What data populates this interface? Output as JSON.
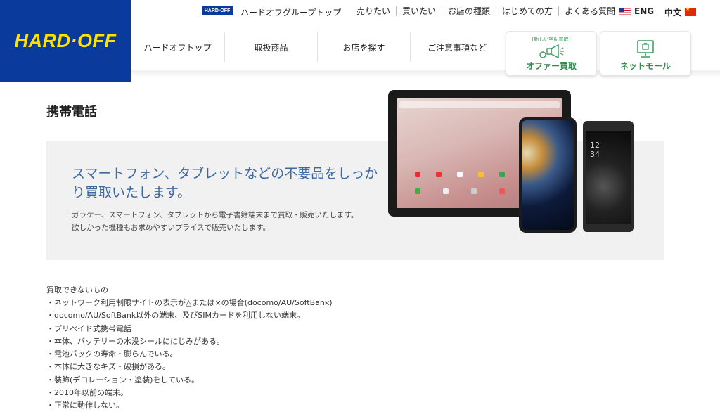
{
  "logo": {
    "text": "HARD·OFF"
  },
  "utility": {
    "group_logo_text": "HARD·OFF",
    "group_link": "ハードオフグループトップ",
    "links": [
      "売りたい",
      "買いたい",
      "お店の種類",
      "はじめての方",
      "よくある質問"
    ],
    "lang_eng": "ENG",
    "lang_cn": "中文"
  },
  "nav": {
    "items": [
      "ハードオフトップ",
      "取扱商品",
      "お店を探す",
      "ご注意事項など"
    ]
  },
  "cta": {
    "offer_small": "[新しい宅配買取]",
    "offer_label": "オファー買取",
    "mall_label": "ネットモール"
  },
  "page": {
    "title": "携帯電話"
  },
  "hero": {
    "heading": "スマートフォン、タブレットなどの不要品をしっかり買取いたします。",
    "desc_line1": "ガラケー、スマートフォン、タブレットから電子書籍端末まで買取・販売いたします。",
    "desc_line2": "欲しかった機種もお求めやすいプライスで販売いたします。",
    "phone_time": "12\n34"
  },
  "non_purchasable": {
    "title": "買取できないもの",
    "items": [
      "ネットワーク利用制限サイトの表示が△または×の場合(docomo/AU/SoftBank)",
      "docomo/AU/SoftBank以外の端末、及びSIMカードを利用しない端末。",
      "プリペイド式携帯電話",
      "本体、バッテリーの水没シールににじみがある。",
      "電池パックの寿命・膨らんでいる。",
      "本体に大きなキズ・破損がある。",
      "装飾(デコレーション・塗装)をしている。",
      "2010年以前の端末。",
      "正常に動作しない。"
    ]
  },
  "colors": {
    "brand_blue": "#0a3a9c",
    "logo_yellow": "#ffe000",
    "heading_blue": "#3a6aa6",
    "cta_green": "#2f8f4f"
  }
}
